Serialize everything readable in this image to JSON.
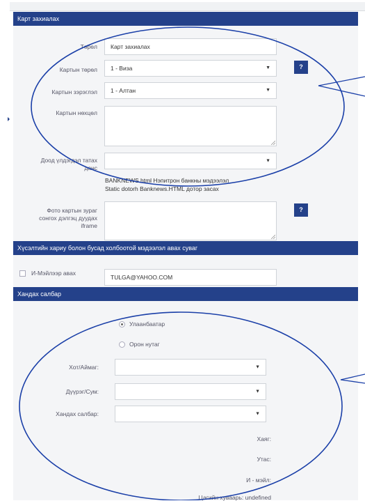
{
  "section1": {
    "title": "Карт захиалах",
    "type_label": "Төрөл",
    "type_value": "Карт захиалах",
    "card_type_label": "Картын төрөл",
    "card_type_value": "1 - Виза",
    "card_level_label": "Картын зэрэглэл",
    "card_level_value": "1 - Алтан",
    "card_terms_label": "Картын нөхцөл",
    "min_balance_label": "Доод үлдэгдэл татах данс",
    "bank_note_1": "BANKNEWS.html Нэпитрон банкны мэдээлэл",
    "bank_note_2": "Static dotorh Banknews.HTML дотор засах",
    "photo_label": "Фото картын зураг сонгох дэлгэц дуудах iframe",
    "help_label": "?"
  },
  "section2": {
    "title": "Хүсэлтийн хариу болон бусад холбоотой мэдээлэл авах суваг",
    "email_label": "И-Мэйлээр авах",
    "email_value": "TULGA@YAHOO.COM"
  },
  "section3": {
    "title": "Хандах салбар",
    "radio_ub": "Улаанбаатар",
    "radio_rural": "Орон нутаг",
    "city_label": "Хот/Аймаг:",
    "district_label": "Дүүрэг/Сум:",
    "branch_label": "Хандах салбар:",
    "address_label": "Хаяг:",
    "phone_label": "Утас:",
    "email_label": "И - мэйл:",
    "last_line": "Цагийн хуваарь: undefined"
  },
  "colors": {
    "header": "#24418a",
    "highlight": "#1a3fa8"
  }
}
